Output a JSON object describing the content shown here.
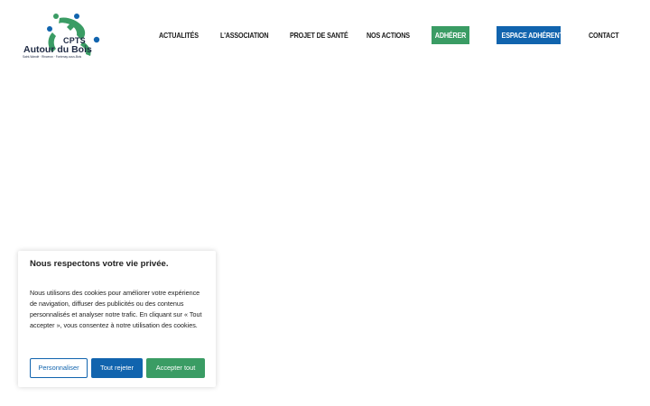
{
  "header": {
    "logo": {
      "acronym": "CPTS",
      "name": "Autour du Bois",
      "subtitle": "Saint-Wandé · Rinceron · Fontenay-sous-Bois"
    },
    "nav": [
      {
        "label": "ACTUALITÉS"
      },
      {
        "label": "L'ASSOCIATION"
      },
      {
        "label": "PROJET DE SANTÉ"
      },
      {
        "label": "NOS ACTIONS"
      },
      {
        "label": "ADHÉRER"
      },
      {
        "label": "ESPACE ADHÉRENT"
      },
      {
        "label": "CONTACT"
      }
    ]
  },
  "cookie_banner": {
    "title": "Nous respectons votre vie privée.",
    "body": "Nous utilisons des cookies pour améliorer votre expérience de navigation, diffuser des publicités ou des contenus personnalisés et analyser notre trafic. En cliquant sur « Tout accepter », vous consentez à notre utilisation des cookies.",
    "buttons": {
      "customize": "Personnaliser",
      "reject": "Tout rejeter",
      "accept": "Accepter tout"
    }
  },
  "colors": {
    "green": "#3a9c64",
    "blue": "#1164ae",
    "text": "#1b1b1b"
  }
}
